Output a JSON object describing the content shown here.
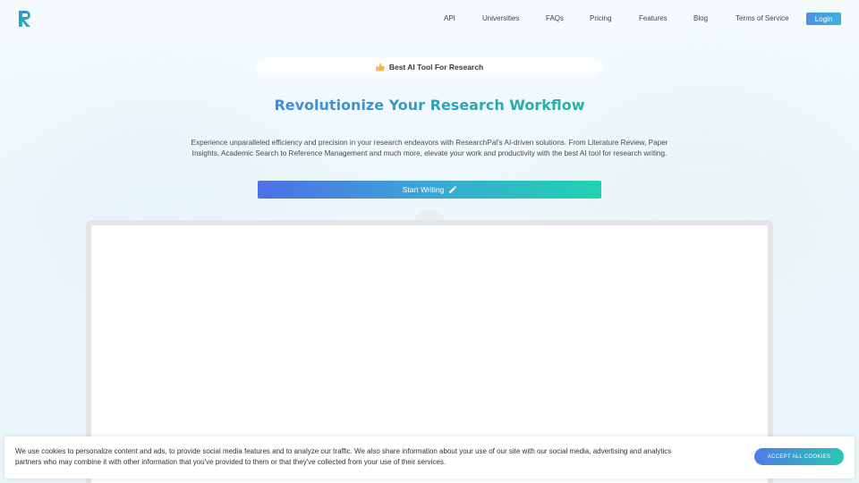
{
  "colors": {
    "brand_blue": "#4a86e0",
    "brand_teal": "#1fb69c",
    "logo_color": "#2a9fd0"
  },
  "header": {
    "logo_icon": "researchpal-r-logo",
    "nav": [
      {
        "label": "API"
      },
      {
        "label": "Universities"
      },
      {
        "label": "FAQs"
      },
      {
        "label": "Pricing"
      },
      {
        "label": "Features"
      },
      {
        "label": "Blog"
      },
      {
        "label": "Terms of Service"
      }
    ],
    "login_label": "Login"
  },
  "badge": {
    "icon": "thumbs-up-icon",
    "label": "Best AI Tool For Research"
  },
  "hero": {
    "headline": "Revolutionize Your Research Workflow",
    "subtext": "Experience unparalleled efficiency and precision in your research endeavors with ResearchPal's AI-driven solutions. From Literature Review, Paper Insights, Academic Search to Reference Management and much more, elevate your work and productivity with the best AI tool for research writing.",
    "cta_label": "Start Writing",
    "cta_icon": "pencil-icon"
  },
  "cookie_banner": {
    "text": "We use cookies to personalize content and ads, to provide social media features and to analyze our traffic. We also share information about your use of our site with our social media, advertising and analytics partners who may combine it with other information that you've provided to them or that they've collected from your use of their services.",
    "accept_label": "ACCEPT ALL COOKIES"
  }
}
